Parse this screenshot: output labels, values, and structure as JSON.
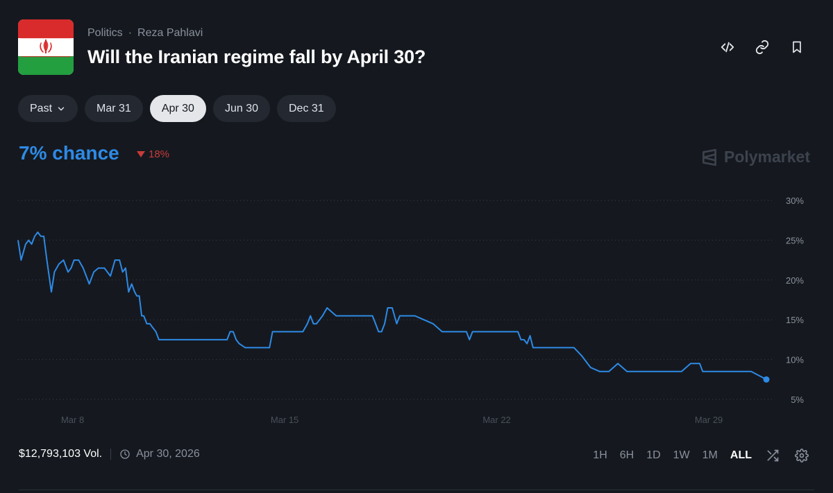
{
  "header": {
    "breadcrumb": [
      "Politics",
      "Reza Pahlavi"
    ],
    "breadcrumb_sep": "·",
    "title": "Will the Iranian regime fall by April 30?"
  },
  "icons": {
    "embed": "code-icon",
    "link": "link-icon",
    "bookmark": "bookmark-icon",
    "flag": "iran-flag-icon"
  },
  "tabs": [
    {
      "label": "Past",
      "has_dropdown": true,
      "active": false
    },
    {
      "label": "Mar 31",
      "active": false
    },
    {
      "label": "Apr 30",
      "active": true
    },
    {
      "label": "Jun 30",
      "active": false
    },
    {
      "label": "Dec 31",
      "active": false
    }
  ],
  "market": {
    "chance": "7% chance",
    "change": "18%",
    "change_direction": "down",
    "brand": "Polymarket"
  },
  "colors": {
    "accent": "#2e8ae6",
    "negative": "#c93a3a",
    "background": "#15191f"
  },
  "chart_data": {
    "type": "line",
    "y_tick_labels": [
      "30%",
      "25%",
      "20%",
      "15%",
      "10%",
      "5%"
    ],
    "ylim": [
      5,
      30
    ],
    "x_tick_labels": [
      "Mar 8",
      "Mar 15",
      "Mar 22",
      "Mar 29"
    ],
    "xlim": [
      6.2,
      30.9
    ],
    "grid": true,
    "x": [
      6.2,
      6.3,
      6.45,
      6.55,
      6.65,
      6.75,
      6.85,
      6.95,
      7.05,
      7.15,
      7.3,
      7.4,
      7.55,
      7.7,
      7.85,
      7.95,
      8.05,
      8.2,
      8.35,
      8.55,
      8.7,
      8.85,
      9.05,
      9.25,
      9.4,
      9.55,
      9.65,
      9.75,
      9.85,
      9.95,
      10.05,
      10.12,
      10.2,
      10.28,
      10.35,
      10.45,
      10.55,
      10.65,
      10.75,
      10.85,
      10.95,
      11.05,
      11.15,
      11.25,
      11.35,
      11.5,
      11.7,
      12.0,
      12.4,
      12.8,
      13.1,
      13.2,
      13.3,
      13.4,
      13.5,
      13.7,
      14.0,
      14.3,
      14.5,
      14.6,
      14.7,
      14.85,
      15.0,
      15.3,
      15.6,
      15.75,
      15.85,
      15.95,
      16.05,
      16.15,
      16.25,
      16.4,
      16.55,
      16.7,
      16.9,
      17.1,
      17.3,
      17.5,
      17.7,
      17.9,
      18.0,
      18.1,
      18.2,
      18.3,
      18.4,
      18.55,
      18.7,
      18.8,
      18.9,
      19.0,
      19.1,
      19.3,
      19.6,
      19.9,
      20.2,
      20.5,
      20.8,
      21.0,
      21.1,
      21.2,
      21.3,
      21.6,
      22.0,
      22.4,
      22.7,
      22.8,
      22.9,
      23.0,
      23.1,
      23.2,
      23.35,
      23.5,
      23.7,
      23.8,
      24.0,
      24.1,
      24.3,
      24.4,
      24.55,
      24.8,
      25.1,
      25.4,
      25.7,
      26.0,
      26.3,
      26.6,
      26.8,
      26.9,
      27.0,
      27.2,
      27.5,
      27.8,
      28.1,
      28.4,
      28.7,
      28.8,
      29.0,
      29.3,
      29.6,
      30.0,
      30.4,
      30.9
    ],
    "y": [
      25.0,
      22.5,
      24.5,
      25.0,
      24.5,
      25.5,
      26.0,
      25.5,
      25.5,
      22.5,
      18.5,
      21.0,
      22.0,
      22.5,
      21.0,
      21.5,
      22.5,
      22.5,
      21.5,
      19.5,
      21.0,
      21.5,
      21.5,
      20.5,
      22.5,
      22.5,
      21.0,
      21.5,
      18.5,
      19.5,
      18.5,
      18.0,
      18.0,
      15.5,
      15.5,
      14.5,
      14.5,
      14.0,
      13.5,
      12.5,
      12.5,
      12.5,
      12.5,
      12.5,
      12.5,
      12.5,
      12.5,
      12.5,
      12.5,
      12.5,
      12.5,
      13.5,
      13.5,
      12.5,
      12.0,
      11.5,
      11.5,
      11.5,
      11.5,
      13.5,
      13.5,
      13.5,
      13.5,
      13.5,
      13.5,
      14.5,
      15.5,
      14.5,
      14.5,
      15.0,
      15.5,
      16.5,
      16.0,
      15.5,
      15.5,
      15.5,
      15.5,
      15.5,
      15.5,
      15.5,
      14.5,
      13.5,
      13.5,
      14.5,
      16.5,
      16.5,
      14.5,
      15.5,
      15.5,
      15.5,
      15.5,
      15.5,
      15.0,
      14.5,
      13.5,
      13.5,
      13.5,
      13.5,
      12.5,
      13.5,
      13.5,
      13.5,
      13.5,
      13.5,
      13.5,
      12.5,
      12.5,
      12.0,
      13.0,
      11.5,
      11.5,
      11.5,
      11.5,
      11.5,
      11.5,
      11.5,
      11.5,
      11.5,
      11.5,
      10.5,
      9.0,
      8.5,
      8.5,
      9.5,
      8.5,
      8.5,
      8.5,
      8.5,
      8.5,
      8.5,
      8.5,
      8.5,
      8.5,
      9.5,
      9.5,
      8.5,
      8.5,
      8.5,
      8.5,
      8.5,
      8.5,
      7.5,
      7.5,
      6.5,
      6.5,
      6.5,
      6.5
    ]
  },
  "footer": {
    "volume": "$12,793,103 Vol.",
    "end_date": "Apr 30, 2026",
    "ranges": [
      "1H",
      "6H",
      "1D",
      "1W",
      "1M",
      "ALL"
    ],
    "active_range": "ALL"
  }
}
